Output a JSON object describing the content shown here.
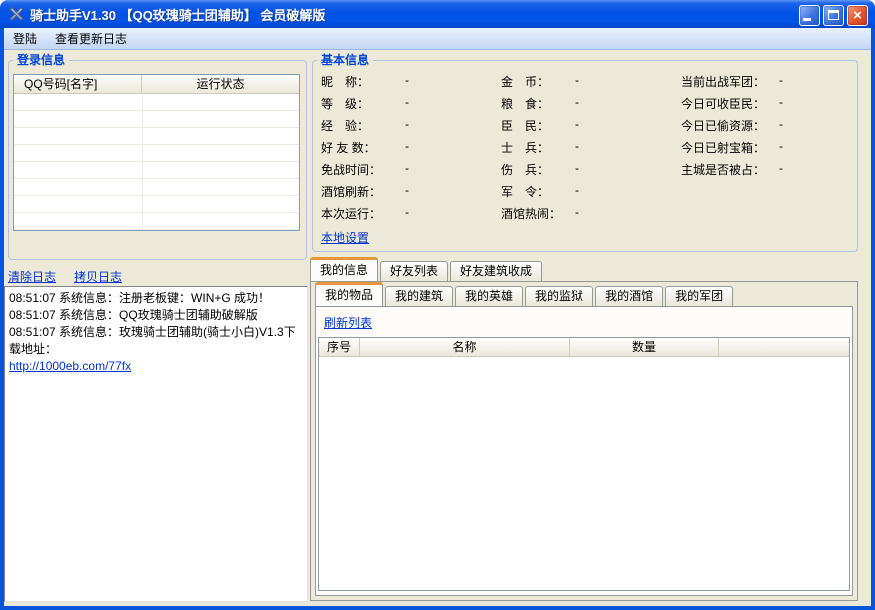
{
  "window": {
    "title": "骑士助手V1.30 【QQ玫瑰骑士团辅助】 会员破解版",
    "controls": {
      "close_glyph": "×"
    }
  },
  "colors": {
    "titlebar_blue": "#0353E6",
    "window_border": "#0855DD",
    "client_bg": "#ECE9D8",
    "section_title": "#0046D5",
    "link": "#0033CC",
    "active_tab_accent": "#E5953A",
    "close_button": "#D8401B"
  },
  "menu": {
    "items": [
      {
        "label": "登陆"
      },
      {
        "label": "查看更新日志"
      }
    ]
  },
  "login_panel": {
    "title": "登录信息",
    "table": {
      "columns": [
        "QQ号码[名字]",
        "运行状态"
      ]
    }
  },
  "log_panel": {
    "clear_link": "清除日志",
    "copy_link": "拷贝日志",
    "lines": [
      "08:51:07 系统信息：注册老板键：WIN+G 成功！",
      "08:51:07 系统信息：QQ玫瑰骑士团辅助破解版",
      "08:51:07 系统信息：玫瑰骑士团辅助(骑士小白)V1.3下载地址："
    ],
    "download_url": "http://1000eb.com/77fx"
  },
  "info_panel": {
    "title": "基本信息",
    "col1": [
      {
        "label": "昵　称：",
        "value": "-"
      },
      {
        "label": "等　级：",
        "value": "-"
      },
      {
        "label": "经　验：",
        "value": "-"
      },
      {
        "label": "好 友 数：",
        "value": "-"
      },
      {
        "label": "免战时间：",
        "value": "-"
      },
      {
        "label": "酒馆刷新：",
        "value": "-"
      },
      {
        "label": "本次运行：",
        "value": "-"
      }
    ],
    "col2": [
      {
        "label": "金　币：",
        "value": "-"
      },
      {
        "label": "粮　食：",
        "value": "-"
      },
      {
        "label": "臣　民：",
        "value": "-"
      },
      {
        "label": "士　兵：",
        "value": "-"
      },
      {
        "label": "伤　兵：",
        "value": "-"
      },
      {
        "label": "军　令：",
        "value": "-"
      },
      {
        "label": "酒馆热闹：",
        "value": "-"
      }
    ],
    "col3": [
      {
        "label": "当前出战军团：",
        "value": "-"
      },
      {
        "label": "今日可收臣民：",
        "value": "-"
      },
      {
        "label": "今日已偷资源：",
        "value": "-"
      },
      {
        "label": "今日已射宝箱：",
        "value": "-"
      },
      {
        "label": "主城是否被占：",
        "value": "-"
      }
    ],
    "settings_link": "本地设置"
  },
  "tabs": {
    "outer": [
      {
        "label": "我的信息",
        "active": true
      },
      {
        "label": "好友列表",
        "active": false
      },
      {
        "label": "好友建筑收成",
        "active": false
      }
    ],
    "inner": [
      {
        "label": "我的物品",
        "active": true
      },
      {
        "label": "我的建筑",
        "active": false
      },
      {
        "label": "我的英雄",
        "active": false
      },
      {
        "label": "我的监狱",
        "active": false
      },
      {
        "label": "我的酒馆",
        "active": false
      },
      {
        "label": "我的军团",
        "active": false
      }
    ],
    "refresh_link": "刷新列表",
    "items_table": {
      "columns": [
        "序号",
        "名称",
        "数量"
      ]
    }
  }
}
